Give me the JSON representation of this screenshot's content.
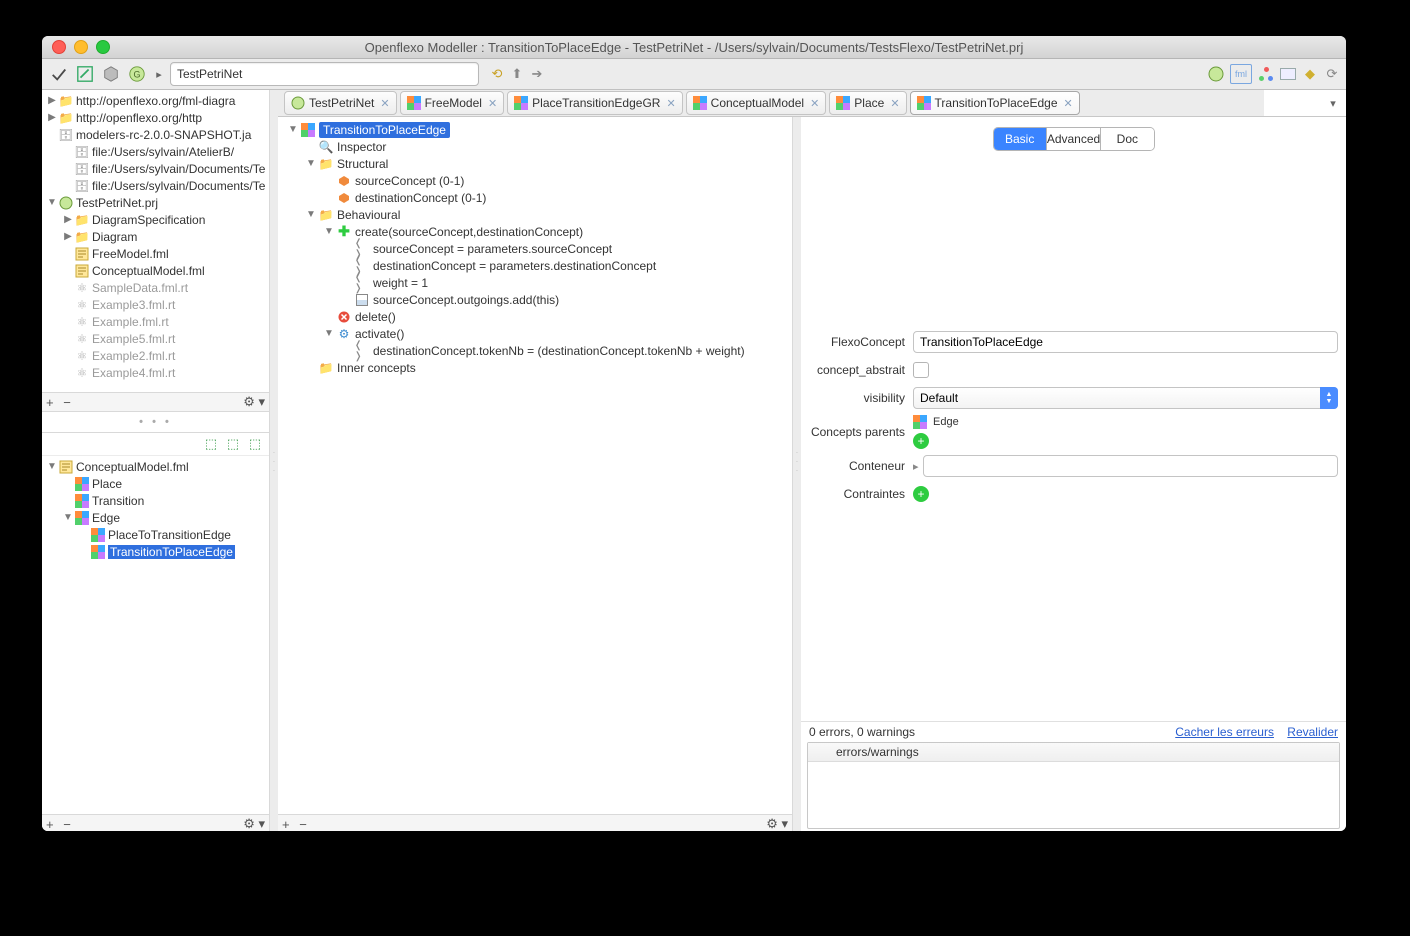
{
  "window": {
    "title": "Openflexo Modeller : TransitionToPlaceEdge - TestPetriNet - /Users/sylvain/Documents/TestsFlexo/TestPetriNet.prj"
  },
  "toolbar": {
    "crumb_current": "TestPetriNet"
  },
  "left_top_tree": [
    {
      "label": "http://openflexo.org/fml-diagra",
      "indent": 0,
      "twist": "▶",
      "icon": "folder"
    },
    {
      "label": "http://openflexo.org/http",
      "indent": 0,
      "twist": "▶",
      "icon": "folder"
    },
    {
      "label": "modelers-rc-2.0.0-SNAPSHOT.ja",
      "indent": 0,
      "twist": "",
      "icon": "db"
    },
    {
      "label": "file:/Users/sylvain/AtelierB/",
      "indent": 1,
      "twist": "",
      "icon": "db"
    },
    {
      "label": "file:/Users/sylvain/Documents/Te",
      "indent": 1,
      "twist": "",
      "icon": "db"
    },
    {
      "label": "file:/Users/sylvain/Documents/Te",
      "indent": 1,
      "twist": "",
      "icon": "db"
    },
    {
      "label": "TestPetriNet.prj",
      "indent": 0,
      "twist": "▼",
      "icon": "proj"
    },
    {
      "label": "DiagramSpecification",
      "indent": 1,
      "twist": "▶",
      "icon": "folder-y"
    },
    {
      "label": "Diagram",
      "indent": 1,
      "twist": "▶",
      "icon": "folder-y"
    },
    {
      "label": "FreeModel.fml",
      "indent": 1,
      "twist": "",
      "icon": "fml"
    },
    {
      "label": "ConceptualModel.fml",
      "indent": 1,
      "twist": "",
      "icon": "fml"
    },
    {
      "label": "SampleData.fml.rt",
      "indent": 1,
      "twist": "",
      "icon": "gray-cluster",
      "gray": true
    },
    {
      "label": "Example3.fml.rt",
      "indent": 1,
      "twist": "",
      "icon": "gray-cluster",
      "gray": true
    },
    {
      "label": "Example.fml.rt",
      "indent": 1,
      "twist": "",
      "icon": "gray-cluster",
      "gray": true
    },
    {
      "label": "Example5.fml.rt",
      "indent": 1,
      "twist": "",
      "icon": "gray-cluster",
      "gray": true
    },
    {
      "label": "Example2.fml.rt",
      "indent": 1,
      "twist": "",
      "icon": "gray-cluster",
      "gray": true
    },
    {
      "label": "Example4.fml.rt",
      "indent": 1,
      "twist": "",
      "icon": "gray-cluster",
      "gray": true
    }
  ],
  "left_bottom_tree": [
    {
      "label": "ConceptualModel.fml",
      "indent": 0,
      "twist": "▼",
      "icon": "fml"
    },
    {
      "label": "Place",
      "indent": 1,
      "twist": "",
      "icon": "multi"
    },
    {
      "label": "Transition",
      "indent": 1,
      "twist": "",
      "icon": "multi"
    },
    {
      "label": "Edge",
      "indent": 1,
      "twist": "▼",
      "icon": "multi"
    },
    {
      "label": "PlaceToTransitionEdge",
      "indent": 2,
      "twist": "",
      "icon": "multi"
    },
    {
      "label": "TransitionToPlaceEdge",
      "indent": 2,
      "twist": "",
      "icon": "multi",
      "selected": true
    }
  ],
  "tabs": [
    {
      "label": "TestPetriNet",
      "icon": "proj"
    },
    {
      "label": "FreeModel",
      "icon": "multi"
    },
    {
      "label": "PlaceTransitionEdgeGR",
      "icon": "multi"
    },
    {
      "label": "ConceptualModel",
      "icon": "multi"
    },
    {
      "label": "Place",
      "icon": "multi"
    },
    {
      "label": "TransitionToPlaceEdge",
      "icon": "multi",
      "active": true
    }
  ],
  "editor_tree": [
    {
      "label": "TransitionToPlaceEdge",
      "indent": 0,
      "twist": "▼",
      "icon": "multi",
      "selected": true
    },
    {
      "label": "Inspector",
      "indent": 1,
      "twist": "",
      "icon": "search"
    },
    {
      "label": "Structural",
      "indent": 1,
      "twist": "▼",
      "icon": "folder-y"
    },
    {
      "label": "sourceConcept (0-1)",
      "indent": 2,
      "twist": "",
      "icon": "orange-hex"
    },
    {
      "label": "destinationConcept (0-1)",
      "indent": 2,
      "twist": "",
      "icon": "orange-hex"
    },
    {
      "label": "Behavioural",
      "indent": 1,
      "twist": "▼",
      "icon": "folder-y"
    },
    {
      "label": "create(sourceConcept,destinationConcept)",
      "indent": 2,
      "twist": "▼",
      "icon": "plus-green"
    },
    {
      "label": "sourceConcept = parameters.sourceConcept",
      "indent": 3,
      "twist": "",
      "icon": "code"
    },
    {
      "label": "destinationConcept = parameters.destinationConcept",
      "indent": 3,
      "twist": "",
      "icon": "code"
    },
    {
      "label": "weight = 1",
      "indent": 3,
      "twist": "",
      "icon": "code"
    },
    {
      "label": "sourceConcept.outgoings.add(this)",
      "indent": 3,
      "twist": "",
      "icon": "grid"
    },
    {
      "label": "delete()",
      "indent": 2,
      "twist": "",
      "icon": "red-x"
    },
    {
      "label": "activate()",
      "indent": 2,
      "twist": "▼",
      "icon": "blue-gear"
    },
    {
      "label": "destinationConcept.tokenNb = (destinationConcept.tokenNb + weight)",
      "indent": 3,
      "twist": "",
      "icon": "code"
    },
    {
      "label": "Inner concepts",
      "indent": 1,
      "twist": "",
      "icon": "folder-y"
    }
  ],
  "right_panel": {
    "segments": [
      "Basic",
      "Advanced",
      "Doc"
    ],
    "active_segment": "Basic",
    "fields": {
      "FlexoConcept_label": "FlexoConcept",
      "FlexoConcept_value": "TransitionToPlaceEdge",
      "concept_abstrait_label": "concept_abstrait",
      "visibility_label": "visibility",
      "visibility_value": "Default",
      "concepts_parents_label": "Concepts parents",
      "concepts_parents_value": "Edge",
      "conteneur_label": "Conteneur",
      "conteneur_value": "",
      "contraintes_label": "Contraintes"
    },
    "errors_summary": "0 errors, 0 warnings",
    "hide_errors": "Cacher les erreurs",
    "revalidate": "Revalider",
    "errors_header": "errors/warnings"
  },
  "footer": {
    "plus": "+",
    "minus": "−",
    "gear": "⚙︎"
  }
}
